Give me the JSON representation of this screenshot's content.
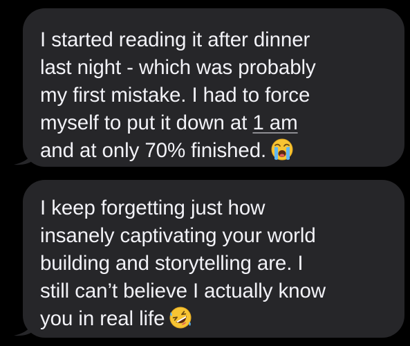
{
  "messages": [
    {
      "lines": [
        "I started reading it after dinner",
        "last night - which was probably",
        "my first mistake. I had to force",
        "myself to put it down at ",
        "and at only 70% finished."
      ],
      "time_link": "1 am",
      "emoji": "loudly-crying-face"
    },
    {
      "lines": [
        "I keep forgetting just how",
        "insanely captivating your world",
        "building and storytelling are. I",
        "still can’t believe I actually know",
        "you in real life"
      ],
      "emoji": "rolling-on-the-floor-laughing-face"
    }
  ],
  "colors": {
    "background": "#000000",
    "bubble": "#262629",
    "text": "#f2f2f7"
  }
}
